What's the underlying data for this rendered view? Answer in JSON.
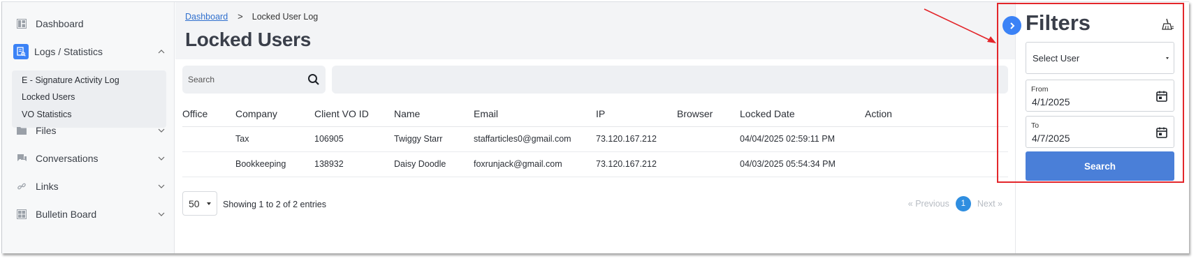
{
  "sidebar": {
    "items": [
      {
        "label": "Dashboard",
        "icon": "dashboard-icon"
      },
      {
        "label": "Logs / Statistics",
        "icon": "logs-statistics-icon",
        "expanded": true
      },
      {
        "label": "Files",
        "icon": "folder-icon"
      },
      {
        "label": "Conversations",
        "icon": "chat-icon"
      },
      {
        "label": "Links",
        "icon": "link-icon"
      },
      {
        "label": "Bulletin Board",
        "icon": "bulletin-board-icon"
      }
    ],
    "submenu": [
      "E - Signature Activity Log",
      "Locked Users",
      "VO Statistics"
    ]
  },
  "breadcrumb": {
    "root": "Dashboard",
    "separator": ">",
    "current": "Locked User Log"
  },
  "page_title": "Locked Users",
  "search": {
    "placeholder": "Search"
  },
  "table": {
    "columns": [
      "Office",
      "Company",
      "Client VO ID",
      "Name",
      "Email",
      "IP",
      "Browser",
      "Locked Date",
      "Action"
    ],
    "rows": [
      [
        "",
        "Tax",
        "106905",
        "Twiggy Starr",
        "staffarticles0@gmail.com",
        "73.120.167.212",
        "",
        "04/04/2025 02:59:11 PM",
        ""
      ],
      [
        "",
        "Bookkeeping",
        "138932",
        "Daisy Doodle",
        "foxrunjack@gmail.com",
        "73.120.167.212",
        "",
        "04/03/2025 05:54:34 PM",
        ""
      ]
    ]
  },
  "pagination": {
    "page_size": "50",
    "entries_text": "Showing 1 to 2 of 2 entries",
    "previous": "« Previous",
    "current_page": "1",
    "next": "Next »"
  },
  "filters": {
    "title": "Filters",
    "select_user": "Select User",
    "from_label": "From",
    "from_value": "4/1/2025",
    "to_label": "To",
    "to_value": "4/7/2025",
    "search_button": "Search"
  },
  "colors": {
    "accent": "#3b82f6",
    "search_button": "#4a7fd8",
    "annotation": "#e3262b"
  }
}
